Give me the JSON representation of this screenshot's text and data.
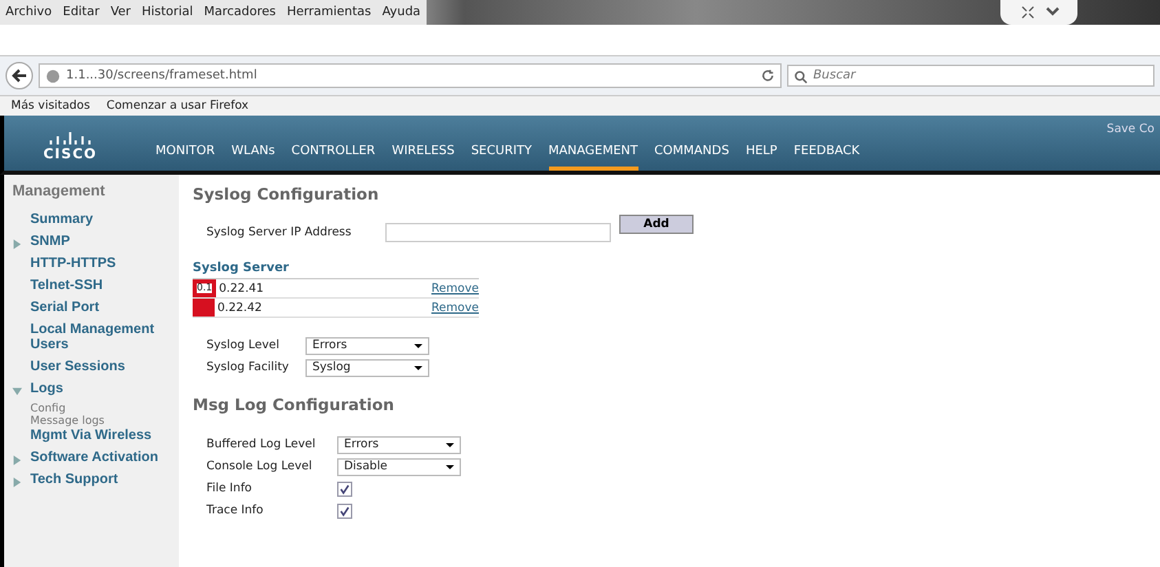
{
  "menu_bar": [
    "Archivo",
    "Editar",
    "Ver",
    "Historial",
    "Marcadores",
    "Herramientas",
    "Ayuda"
  ],
  "address_bar": {
    "url": "1.1...30/screens/frameset.html",
    "search_placeholder": "Buscar"
  },
  "bookmarks": [
    "Más visitados",
    "Comenzar a usar Firefox"
  ],
  "header": {
    "logo": "CISCO",
    "save_link": "Save Co",
    "nav": [
      {
        "label": "MONITOR",
        "selected": false
      },
      {
        "label": "WLANs",
        "selected": false
      },
      {
        "label": "CONTROLLER",
        "selected": false
      },
      {
        "label": "WIRELESS",
        "selected": false
      },
      {
        "label": "SECURITY",
        "selected": false
      },
      {
        "label": "MANAGEMENT",
        "selected": true
      },
      {
        "label": "COMMANDS",
        "selected": false
      },
      {
        "label": "HELP",
        "selected": false
      },
      {
        "label": "FEEDBACK",
        "selected": false
      }
    ]
  },
  "sidebar": {
    "title": "Management",
    "items": [
      {
        "kind": "link",
        "label": "Summary"
      },
      {
        "kind": "group",
        "label": "SNMP",
        "expanded": false
      },
      {
        "kind": "link",
        "label": "HTTP-HTTPS"
      },
      {
        "kind": "link",
        "label": "Telnet-SSH"
      },
      {
        "kind": "link",
        "label": "Serial Port"
      },
      {
        "kind": "link",
        "label": "Local Management Users"
      },
      {
        "kind": "link",
        "label": "User Sessions"
      },
      {
        "kind": "group",
        "label": "Logs",
        "expanded": true,
        "children": [
          {
            "label": "Config"
          },
          {
            "label": "Message logs"
          }
        ]
      },
      {
        "kind": "link",
        "label": "Mgmt Via Wireless"
      },
      {
        "kind": "group",
        "label": "Software Activation",
        "expanded": false
      },
      {
        "kind": "group",
        "label": "Tech Support",
        "expanded": false
      }
    ]
  },
  "syslog": {
    "title": "Syslog Configuration",
    "ip_label": "Syslog Server IP Address",
    "add_button": "Add",
    "servers_title": "Syslog Server",
    "servers": [
      {
        "redacted_text": "0.1",
        "address": "0.22.41",
        "action": "Remove"
      },
      {
        "address": "0.22.42",
        "action": "Remove"
      }
    ],
    "settings": [
      {
        "label": "Syslog Level",
        "value": "Errors"
      },
      {
        "label": "Syslog Facility",
        "value": "Syslog"
      }
    ]
  },
  "msglog": {
    "title": "Msg Log Configuration",
    "rows": [
      {
        "kind": "select",
        "label": "Buffered Log Level",
        "value": "Errors"
      },
      {
        "kind": "select",
        "label": "Console Log Level",
        "value": "Disable"
      },
      {
        "kind": "checkbox",
        "label": "File Info",
        "checked": true
      },
      {
        "kind": "checkbox",
        "label": "Trace Info",
        "checked": true
      }
    ]
  }
}
